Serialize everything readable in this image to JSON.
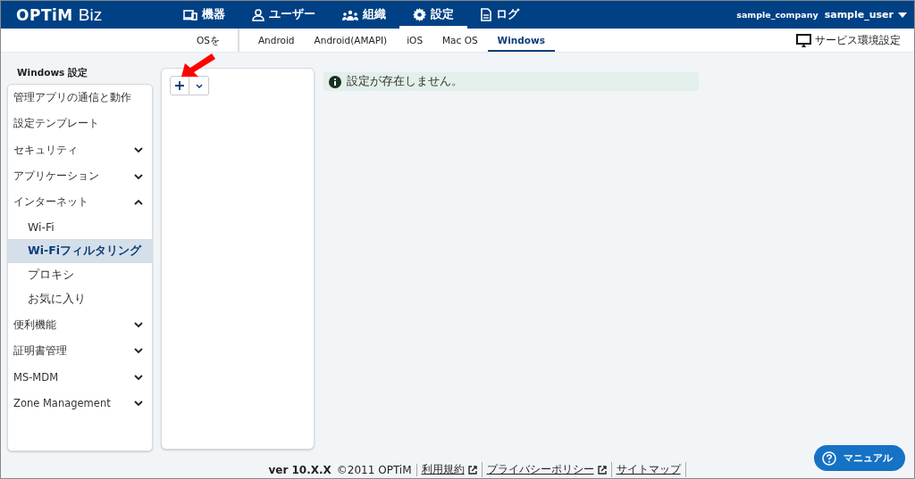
{
  "header": {
    "logo": "OPTiM",
    "logo_suffix": "Biz",
    "nav": [
      {
        "label": "機器",
        "selected": false
      },
      {
        "label": "ユーザー",
        "selected": false
      },
      {
        "label": "組織",
        "selected": false
      },
      {
        "label": "設定",
        "selected": true
      },
      {
        "label": "ログ",
        "selected": false
      }
    ],
    "company": "sample_company",
    "user": "sample_user"
  },
  "os_tabs": [
    {
      "label": "OSを",
      "selected": false
    },
    {
      "label": "Android",
      "selected": false
    },
    {
      "label": "Android(AMAPI)",
      "selected": false
    },
    {
      "label": "iOS",
      "selected": false
    },
    {
      "label": "Mac OS",
      "selected": false
    },
    {
      "label": "Windows",
      "selected": true
    }
  ],
  "service_settings": "サービス環境設定",
  "sidebar": {
    "title": "Windows 設定",
    "items": [
      {
        "label": "管理アプリの通信と動作",
        "selected": false
      },
      {
        "label": "設定テンプレート",
        "selected": false
      },
      {
        "label": "セキュリティ",
        "selected": false,
        "expanded": false
      },
      {
        "label": "アプリケーション",
        "selected": false,
        "expanded": false
      },
      {
        "label": "インターネット",
        "selected": false,
        "expanded": true,
        "children": [
          {
            "label": "Wi-Fi",
            "selected": false
          },
          {
            "label": "Wi-Fiフィルタリング",
            "selected": true
          },
          {
            "label": "プロキシ",
            "selected": false
          },
          {
            "label": "お気に入り",
            "selected": false
          }
        ]
      },
      {
        "label": "便利機能",
        "selected": false,
        "expanded": false
      },
      {
        "label": "証明書管理",
        "selected": false,
        "expanded": false
      },
      {
        "label": "MS-MDM",
        "selected": false,
        "expanded": false
      },
      {
        "label": "Zone Management",
        "selected": false,
        "expanded": false
      }
    ]
  },
  "message": "設定が存在しません。",
  "footer": {
    "version": "ver 10.X.X",
    "copyright": "©2011 OPTiM",
    "links": [
      {
        "label": "利用規約",
        "external": true
      },
      {
        "label": "プライバシーポリシー",
        "external": true
      },
      {
        "label": "サイトマップ",
        "external": false
      }
    ]
  },
  "manual_button": "マニュアル"
}
